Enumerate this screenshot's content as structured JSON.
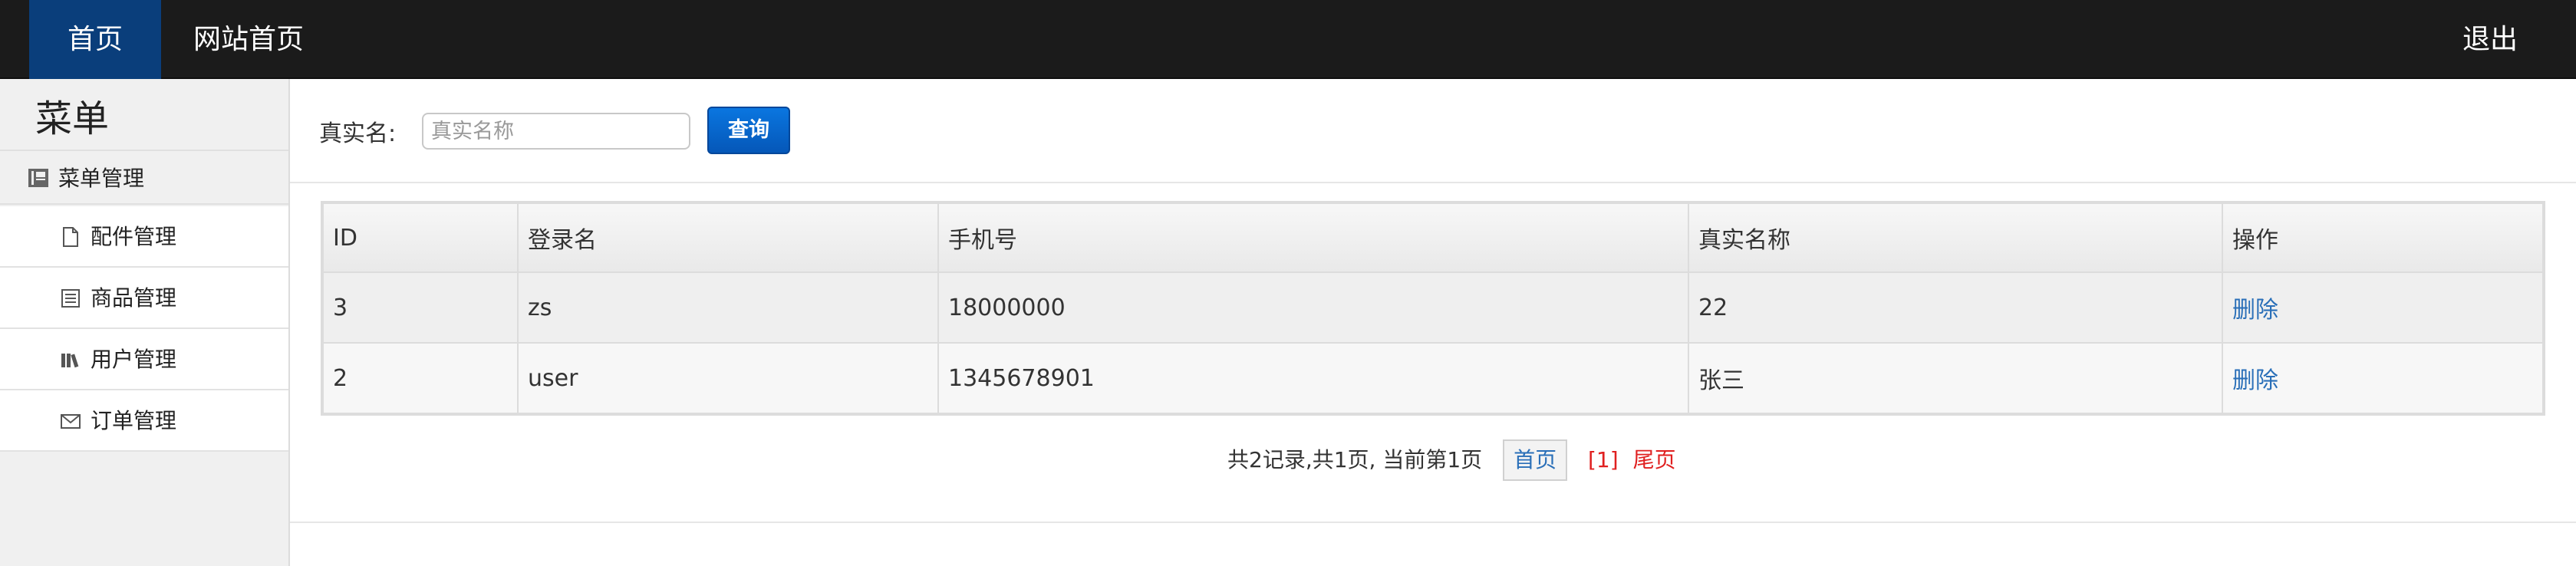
{
  "navbar": {
    "home": "首页",
    "site_home": "网站首页",
    "logout": "退出"
  },
  "sidebar": {
    "title": "菜单",
    "group": {
      "label": "菜单管理",
      "icon": "book-icon"
    },
    "items": [
      {
        "label": "配件管理",
        "icon": "document-icon"
      },
      {
        "label": "商品管理",
        "icon": "list-icon"
      },
      {
        "label": "用户管理",
        "icon": "books-icon"
      },
      {
        "label": "订单管理",
        "icon": "envelope-icon"
      }
    ]
  },
  "search": {
    "label": "真实名:",
    "placeholder": "真实名称",
    "value": "",
    "button": "查询"
  },
  "table": {
    "headers": [
      "ID",
      "登录名",
      "手机号",
      "真实名称",
      "操作"
    ],
    "rows": [
      {
        "id": "3",
        "login": "zs",
        "phone": "18000000",
        "real_name": "22",
        "action": "删除"
      },
      {
        "id": "2",
        "login": "user",
        "phone": "1345678901",
        "real_name": "张三",
        "action": "删除"
      }
    ]
  },
  "pagination": {
    "summary": "共2记录,共1页, 当前第1页",
    "first": "首页",
    "current": "[1]",
    "last": "尾页"
  },
  "colors": {
    "navbar_bg": "#1b1b1b",
    "nav_active_bg": "#0a3e7b",
    "link": "#2a6fb8",
    "pager_red": "#e02020",
    "button_blue": "#0a6ad0"
  }
}
